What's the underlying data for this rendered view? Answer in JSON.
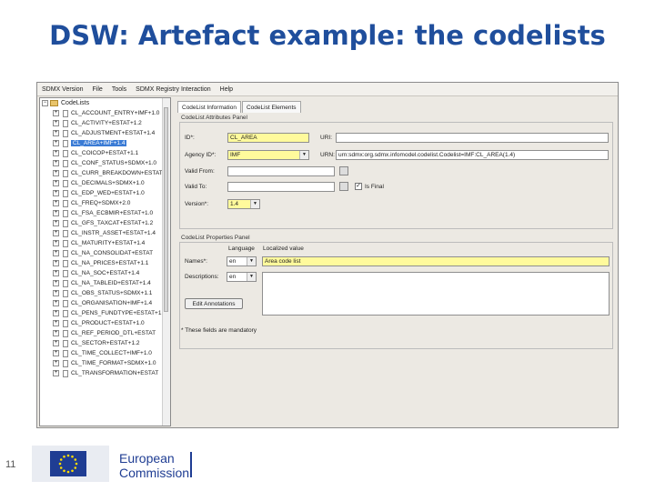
{
  "slide": {
    "title": "DSW: Artefact example: the codelists",
    "page_number": "11"
  },
  "menubar": [
    "SDMX Version",
    "File",
    "Tools",
    "SDMX Registry Interaction",
    "Help"
  ],
  "tree": {
    "root_label": "CodeLists",
    "items": [
      "CL_ACCOUNT_ENTRY+IMF+1.0",
      "CL_ACTIVITY+ESTAT+1.2",
      "CL_ADJUSTMENT+ESTAT+1.4",
      "CL_AREA+IMF+1.4",
      "CL_COICOP+ESTAT+1.1",
      "CL_CONF_STATUS+SDMX+1.0",
      "CL_CURR_BREAKDOWN+ESTAT",
      "CL_DECIMALS+SDMX+1.0",
      "CL_EDP_WED+ESTAT+1.0",
      "CL_FREQ+SDMX+2.0",
      "CL_FSA_ECBMIR+ESTAT+1.0",
      "CL_GFS_TAXCAT+ESTAT+1.2",
      "CL_INSTR_ASSET+ESTAT+1.4",
      "CL_MATURITY+ESTAT+1.4",
      "CL_NA_CONSOLIDAT+ESTAT",
      "CL_NA_PRICES+ESTAT+1.1",
      "CL_NA_SOC+ESTAT+1.4",
      "CL_NA_TABLEID+ESTAT+1.4",
      "CL_OBS_STATUS+SDMX+1.1",
      "CL_ORGANISATION+IMF+1.4",
      "CL_PENS_FUNDTYPE+ESTAT+1.0",
      "CL_PRODUCT+ESTAT+1.0",
      "CL_REF_PERIOD_DTL+ESTAT",
      "CL_SECTOR+ESTAT+1.2",
      "CL_TIME_COLLECT+IMF+1.0",
      "CL_TIME_FORMAT+SDMX+1.0",
      "CL_TRANSFORMATION+ESTAT"
    ],
    "selected_index": 3
  },
  "tabs": [
    "CodeList Information",
    "CodeList Elements"
  ],
  "attributes_panel": {
    "title": "CodeList Attributes Panel",
    "id_label": "ID*:",
    "id_value": "CL_AREA",
    "uri_label": "URI:",
    "uri_value": "",
    "agency_label": "Agency ID*:",
    "agency_value": "IMF",
    "urn_label": "URN:",
    "urn_value": "urn:sdmx:org.sdmx.infomodel.codelist.Codelist=IMF:CL_AREA(1.4)",
    "valid_from_label": "Valid From:",
    "valid_to_label": "Valid To:",
    "is_final_label": "Is Final",
    "is_final_checked": true,
    "version_label": "Version*:",
    "version_value": "1.4"
  },
  "properties_panel": {
    "title": "CodeList Properties Panel",
    "language_header": "Language",
    "localized_header": "Localized value",
    "names_label": "Names*:",
    "names_lang": "en",
    "names_value": "Area code list",
    "descriptions_label": "Descriptions:",
    "descriptions_lang": "en",
    "edit_annotations_label": "Edit Annotations"
  },
  "mandatory_note": "* These fields are mandatory",
  "logo": {
    "line1": "European",
    "line2": "Commission"
  },
  "colors": {
    "title": "#1f4e9c",
    "selected": "#3a7bd5",
    "mandatory_field": "#fffa9c",
    "eu_blue": "#1f3d93"
  }
}
